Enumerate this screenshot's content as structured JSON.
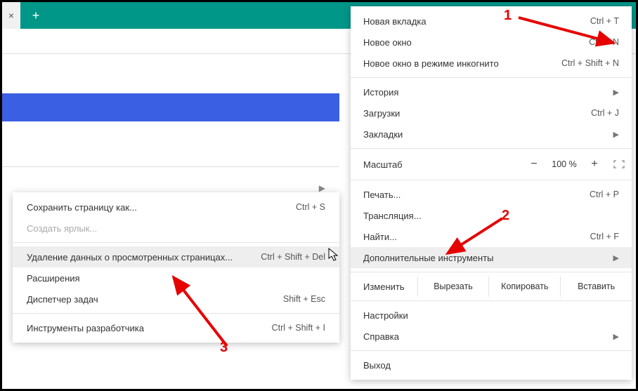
{
  "titlebar": {
    "tab_close": "×",
    "new_tab": "+",
    "minimize": "—",
    "maximize": "☐",
    "close": "✕"
  },
  "toolbar": {
    "star": "☆",
    "profile": "👤"
  },
  "menu": {
    "new_tab": {
      "label": "Новая вкладка",
      "shortcut": "Ctrl + T"
    },
    "new_window": {
      "label": "Новое окно",
      "shortcut": "Ctrl + N"
    },
    "incognito": {
      "label": "Новое окно в режиме инкогнито",
      "shortcut": "Ctrl + Shift + N"
    },
    "history": {
      "label": "История"
    },
    "downloads": {
      "label": "Загрузки",
      "shortcut": "Ctrl + J"
    },
    "bookmarks": {
      "label": "Закладки"
    },
    "zoom": {
      "label": "Масштаб",
      "minus": "−",
      "value": "100 %",
      "plus": "+"
    },
    "print": {
      "label": "Печать...",
      "shortcut": "Ctrl + P"
    },
    "cast": {
      "label": "Трансляция..."
    },
    "find": {
      "label": "Найти...",
      "shortcut": "Ctrl + F"
    },
    "more_tools": {
      "label": "Дополнительные инструменты"
    },
    "edit": {
      "label": "Изменить",
      "cut": "Вырезать",
      "copy": "Копировать",
      "paste": "Вставить"
    },
    "settings": {
      "label": "Настройки"
    },
    "help": {
      "label": "Справка"
    },
    "exit": {
      "label": "Выход"
    }
  },
  "submenu": {
    "save_as": {
      "label": "Сохранить страницу как...",
      "shortcut": "Ctrl + S"
    },
    "create_shortcut": {
      "label": "Создать ярлык..."
    },
    "clear_data": {
      "label": "Удаление данных о просмотренных страницах...",
      "shortcut": "Ctrl + Shift + Del"
    },
    "extensions": {
      "label": "Расширения"
    },
    "task_manager": {
      "label": "Диспетчер задач",
      "shortcut": "Shift + Esc"
    },
    "dev_tools": {
      "label": "Инструменты разработчика",
      "shortcut": "Ctrl + Shift + I"
    }
  },
  "annotations": {
    "one": "1",
    "two": "2",
    "three": "3"
  }
}
